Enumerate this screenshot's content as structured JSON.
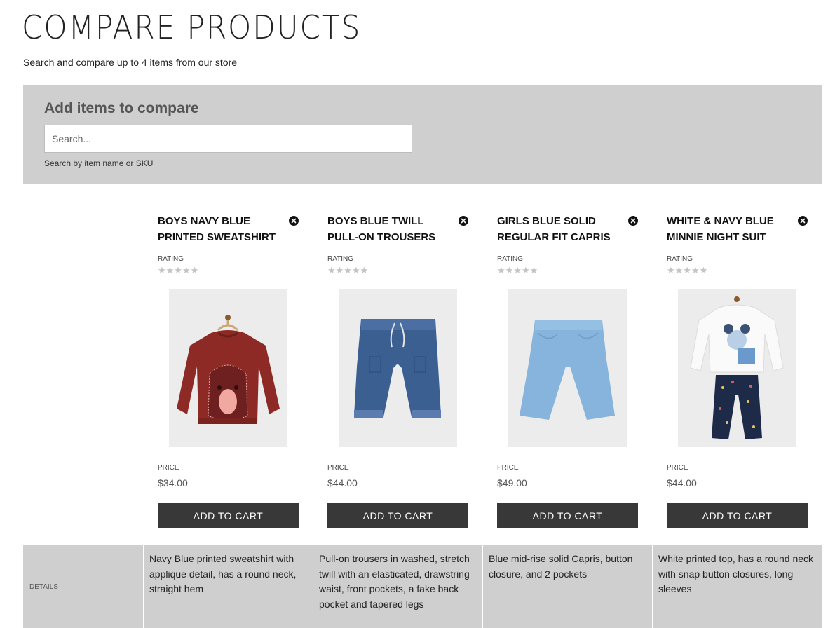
{
  "header": {
    "title": "COMPARE PRODUCTS",
    "subtitle": "Search and compare up to 4 items from our store"
  },
  "search": {
    "heading": "Add items to compare",
    "placeholder": "Search...",
    "hint": "Search by item name or SKU"
  },
  "labels": {
    "rating": "RATING",
    "price": "PRICE",
    "add_to_cart": "ADD TO CART",
    "details": "DETAILS"
  },
  "products": [
    {
      "name": "BOYS NAVY BLUE PRINTED SWEATSHIRT",
      "rating": 0,
      "price": "$34.00",
      "image_icon": "maroon-sweatshirt-image",
      "details": "Navy Blue printed sweatshirt with applique detail, has a round neck, straight hem"
    },
    {
      "name": "BOYS BLUE TWILL PULL-ON TROUSERS",
      "rating": 0,
      "price": "$44.00",
      "image_icon": "denim-trousers-image",
      "details": "Pull-on trousers in washed, stretch twill with an elasticated, drawstring waist, front pockets, a fake back pocket and tapered legs"
    },
    {
      "name": "GIRLS BLUE SOLID REGULAR FIT CAPRIS",
      "rating": 0,
      "price": "$49.00",
      "image_icon": "light-blue-capris-image",
      "details": "Blue mid-rise solid Capris, button closure, and 2 pockets"
    },
    {
      "name": "WHITE & NAVY BLUE MINNIE NIGHT SUIT",
      "rating": 0,
      "price": "$44.00",
      "image_icon": "minnie-night-suit-image",
      "details": "White printed top, has a round neck with snap button closures, long sleeves"
    }
  ],
  "colors": {
    "panel": "#cfcfcf",
    "button": "#383838",
    "star_empty": "#c4c4c4"
  }
}
